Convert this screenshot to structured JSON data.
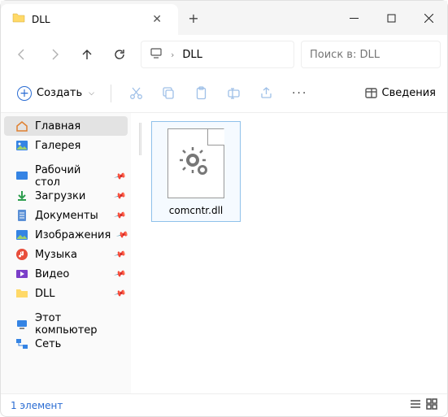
{
  "tab": {
    "title": "DLL"
  },
  "breadcrumb": {
    "item": "DLL"
  },
  "search": {
    "placeholder": "Поиск в: DLL"
  },
  "cmd": {
    "create": "Создать",
    "details": "Сведения"
  },
  "sidebar": {
    "home": "Главная",
    "gallery": "Галерея",
    "desktop": "Рабочий стол",
    "downloads": "Загрузки",
    "documents": "Документы",
    "pictures": "Изображения",
    "music": "Музыка",
    "videos": "Видео",
    "dll": "DLL",
    "thispc": "Этот компьютер",
    "network": "Сеть"
  },
  "files": {
    "item0": "comcntr.dll"
  },
  "status": {
    "count": "1 элемент"
  }
}
